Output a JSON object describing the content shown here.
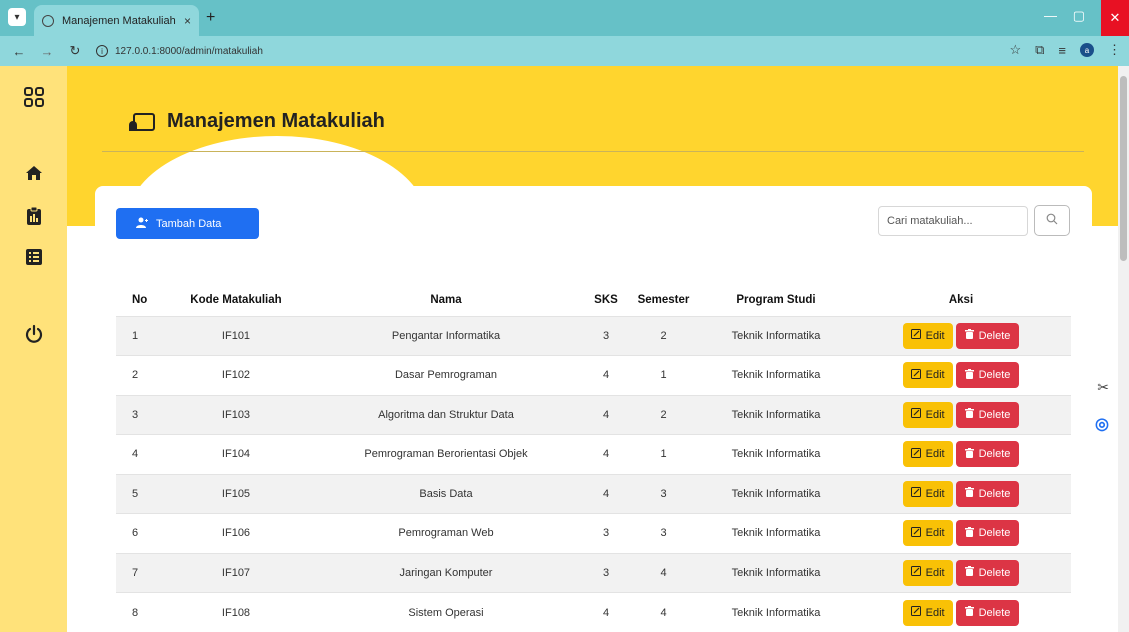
{
  "browser": {
    "tab_title": "Manajemen Matakuliah",
    "tab_close": "×",
    "new_tab": "+",
    "url": "127.0.0.1:8000/admin/matakuliah"
  },
  "sidebar": {
    "items": [
      "grid-icon",
      "home-icon",
      "clipboard-icon",
      "list-icon",
      "power-icon"
    ]
  },
  "header": {
    "title": "Manajemen Matakuliah"
  },
  "toolbar": {
    "add_label": "Tambah Data",
    "search_placeholder": "Cari matakuliah..."
  },
  "table": {
    "headers": [
      "No",
      "Kode Matakuliah",
      "Nama",
      "SKS",
      "Semester",
      "Program Studi",
      "Aksi"
    ],
    "edit_label": "Edit",
    "delete_label": "Delete",
    "rows": [
      {
        "no": "1",
        "kode": "IF101",
        "nama": "Pengantar Informatika",
        "sks": "3",
        "semester": "2",
        "prodi": "Teknik Informatika"
      },
      {
        "no": "2",
        "kode": "IF102",
        "nama": "Dasar Pemrograman",
        "sks": "4",
        "semester": "1",
        "prodi": "Teknik Informatika"
      },
      {
        "no": "3",
        "kode": "IF103",
        "nama": "Algoritma dan Struktur Data",
        "sks": "4",
        "semester": "2",
        "prodi": "Teknik Informatika"
      },
      {
        "no": "4",
        "kode": "IF104",
        "nama": "Pemrograman Berorientasi Objek",
        "sks": "4",
        "semester": "1",
        "prodi": "Teknik Informatika"
      },
      {
        "no": "5",
        "kode": "IF105",
        "nama": "Basis Data",
        "sks": "4",
        "semester": "3",
        "prodi": "Teknik Informatika"
      },
      {
        "no": "6",
        "kode": "IF106",
        "nama": "Pemrograman Web",
        "sks": "3",
        "semester": "3",
        "prodi": "Teknik Informatika"
      },
      {
        "no": "7",
        "kode": "IF107",
        "nama": "Jaringan Komputer",
        "sks": "3",
        "semester": "4",
        "prodi": "Teknik Informatika"
      },
      {
        "no": "8",
        "kode": "IF108",
        "nama": "Sistem Operasi",
        "sks": "4",
        "semester": "4",
        "prodi": "Teknik Informatika"
      }
    ]
  }
}
